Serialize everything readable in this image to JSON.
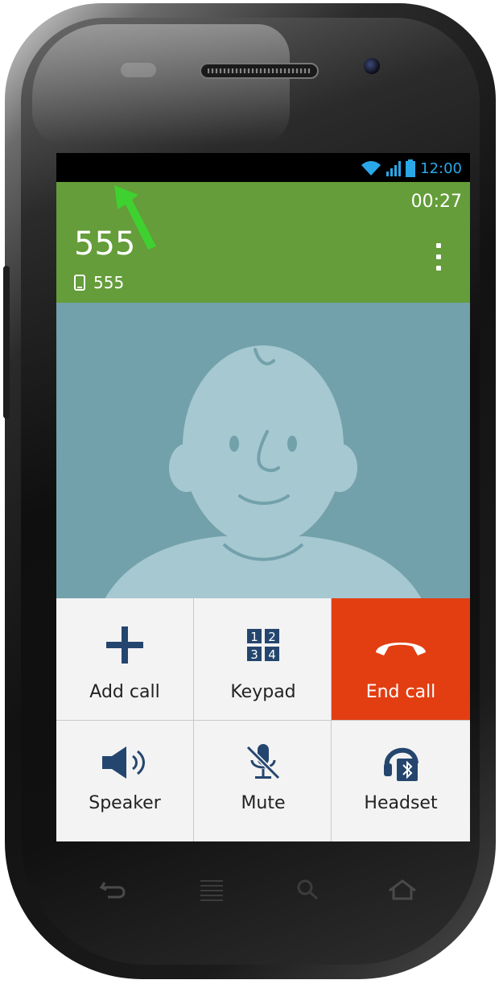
{
  "status_bar": {
    "time": "12:00",
    "icons": [
      "wifi-icon",
      "signal-icon",
      "battery-icon"
    ],
    "accent_color": "#2aa7e8"
  },
  "call_header": {
    "duration": "00:27",
    "caller_name": "555",
    "number_type_icon": "phone-icon",
    "caller_number": "555",
    "menu_icon": "overflow-menu-icon",
    "background_color": "#649d3a"
  },
  "contact_photo": {
    "icon": "default-avatar-icon",
    "background_color": "#72a1ab"
  },
  "call_actions": [
    {
      "label": "Add call",
      "icon": "plus-icon"
    },
    {
      "label": "Keypad",
      "icon": "keypad-icon",
      "keys": [
        "1",
        "2",
        "3",
        "4"
      ]
    },
    {
      "label": "End call",
      "icon": "end-call-icon",
      "color": "#e23e12"
    },
    {
      "label": "Speaker",
      "icon": "speaker-icon"
    },
    {
      "label": "Mute",
      "icon": "mute-microphone-icon"
    },
    {
      "label": "Headset",
      "icon": "bluetooth-headset-icon"
    }
  ],
  "hardware_keys": [
    "back-icon",
    "menu-icon",
    "search-icon",
    "home-icon"
  ]
}
